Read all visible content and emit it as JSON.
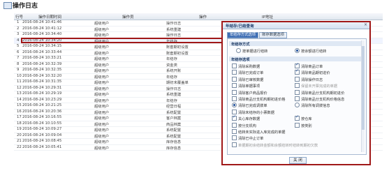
{
  "page": {
    "title": "操作日志"
  },
  "grid": {
    "headers": [
      "行号",
      "操作日期时间",
      "操作员",
      "操作",
      "IP地址"
    ],
    "rows": [
      {
        "n": "1",
        "dt": "2016-08-24 10:41:46",
        "op": "超级用户",
        "act": "操作日志"
      },
      {
        "n": "2",
        "dt": "2016-08-24 10:41:12",
        "op": "超级用户",
        "act": "系统重建"
      },
      {
        "n": "3",
        "dt": "2016-08-24 10:34:40",
        "op": "超级用户",
        "act": "操作日志"
      },
      {
        "n": "4",
        "dt": "2016-08-24 10:34:20",
        "op": "超级用户",
        "act": "年结存"
      },
      {
        "n": "5",
        "dt": "2016-08-24 10:34:15",
        "op": "超级用户",
        "act": "账套期初设置"
      },
      {
        "n": "6",
        "dt": "2016-08-24 10:33:44",
        "op": "超级用户",
        "act": "账套期初设置"
      },
      {
        "n": "7",
        "dt": "2016-08-24 10:33:21",
        "op": "超级用户",
        "act": "年结存"
      },
      {
        "n": "8",
        "dt": "2016-08-24 10:32:39",
        "op": "超级用户",
        "act": "资金类"
      },
      {
        "n": "9",
        "dt": "2016-08-24 10:32:35",
        "op": "超级用户",
        "act": "系统开账"
      },
      {
        "n": "10",
        "dt": "2016-08-24 10:32:20",
        "op": "超级用户",
        "act": "年结存"
      },
      {
        "n": "11",
        "dt": "2016-08-24 10:31:35",
        "op": "超级用户",
        "act": "期初未覆盖单"
      },
      {
        "n": "12",
        "dt": "2016-08-24 10:29:31",
        "op": "超级用户",
        "act": "操作日志"
      },
      {
        "n": "13",
        "dt": "2016-08-24 10:29:19",
        "op": "超级用户",
        "act": "系统重建"
      },
      {
        "n": "14",
        "dt": "2016-08-24 10:23:29",
        "op": "超级用户",
        "act": "年结存"
      },
      {
        "n": "15",
        "dt": "2016-08-24 10:21:25",
        "op": "超级用户",
        "act": "经营日程"
      },
      {
        "n": "16",
        "dt": "2016-08-24 10:20:36",
        "op": "超级用户",
        "act": "系统配置"
      },
      {
        "n": "17",
        "dt": "2016-08-24 10:16:55",
        "op": "超级用户",
        "act": "客户档案"
      },
      {
        "n": "18",
        "dt": "2016-08-24 10:10:55",
        "op": "超级用户",
        "act": "商品档案"
      },
      {
        "n": "19",
        "dt": "2016-08-24 10:09:27",
        "op": "超级用户",
        "act": "系统配置"
      },
      {
        "n": "20",
        "dt": "2016-08-24 10:09:04",
        "op": "超级用户",
        "act": "系统配置"
      },
      {
        "n": "21",
        "dt": "2016-08-24 10:08:45",
        "op": "超级用户",
        "act": "库存信息"
      },
      {
        "n": "22",
        "dt": "2016-08-24 10:05:41",
        "op": "超级用户",
        "act": "库存信息"
      }
    ]
  },
  "dialog": {
    "title": "年结存/已结查询",
    "tabs": [
      "年结存方式选项",
      "账存数据选项"
    ],
    "section1": "年结存方式",
    "mode_left": "按单据进行结转",
    "mode_right": "按余额进行结转",
    "section2": "年结存选项",
    "options": [
      {
        "label": "清除采购数据",
        "checked": false
      },
      {
        "label": "清除商品订单",
        "checked": true
      },
      {
        "label": "清除已完成订单",
        "checked": false
      },
      {
        "label": "清除商品期初进价",
        "checked": true
      },
      {
        "label": "清除已审核数据",
        "checked": false
      },
      {
        "label": "清除操作日志",
        "checked": false
      },
      {
        "label": "清除单据事项",
        "checked": false
      },
      {
        "label": "保留未开票完成的单据",
        "checked": false,
        "muted": true
      },
      {
        "label": "清除客户商品报价",
        "checked": false
      },
      {
        "label": "清除商品分支机构期初进价",
        "checked": false
      },
      {
        "label": "清除商品分支机构期初进价格",
        "checked": false
      },
      {
        "label": "清除商品分支机构价格信息",
        "checked": false
      },
      {
        "label": "清除已完成调拨单",
        "checked": true,
        "radio": true
      },
      {
        "label": "清除所有调拨信息",
        "checked": false,
        "radio": true
      },
      {
        "label": "清除未结存的小票数据",
        "checked": false
      },
      {
        "label": "",
        "checked": false,
        "blank": true
      },
      {
        "label": "关心库存数据",
        "checked": true
      },
      {
        "label": "按仓库",
        "checked": true
      },
      {
        "label": "按分支机构",
        "checked": false
      },
      {
        "label": "按类别",
        "checked": false
      },
      {
        "label": "结转未实际进入库完成的单据",
        "checked": false
      },
      {
        "label": "",
        "checked": false,
        "blank": true
      },
      {
        "label": "清除已中止订单",
        "checked": false
      },
      {
        "label": "",
        "checked": false,
        "blank": true
      },
      {
        "label": "单据期初余结转金额和余额结转时结转到期初欠款",
        "checked": false,
        "muted": true
      },
      {
        "label": "",
        "checked": false,
        "blank": true
      }
    ],
    "close_label": "关 闭"
  }
}
